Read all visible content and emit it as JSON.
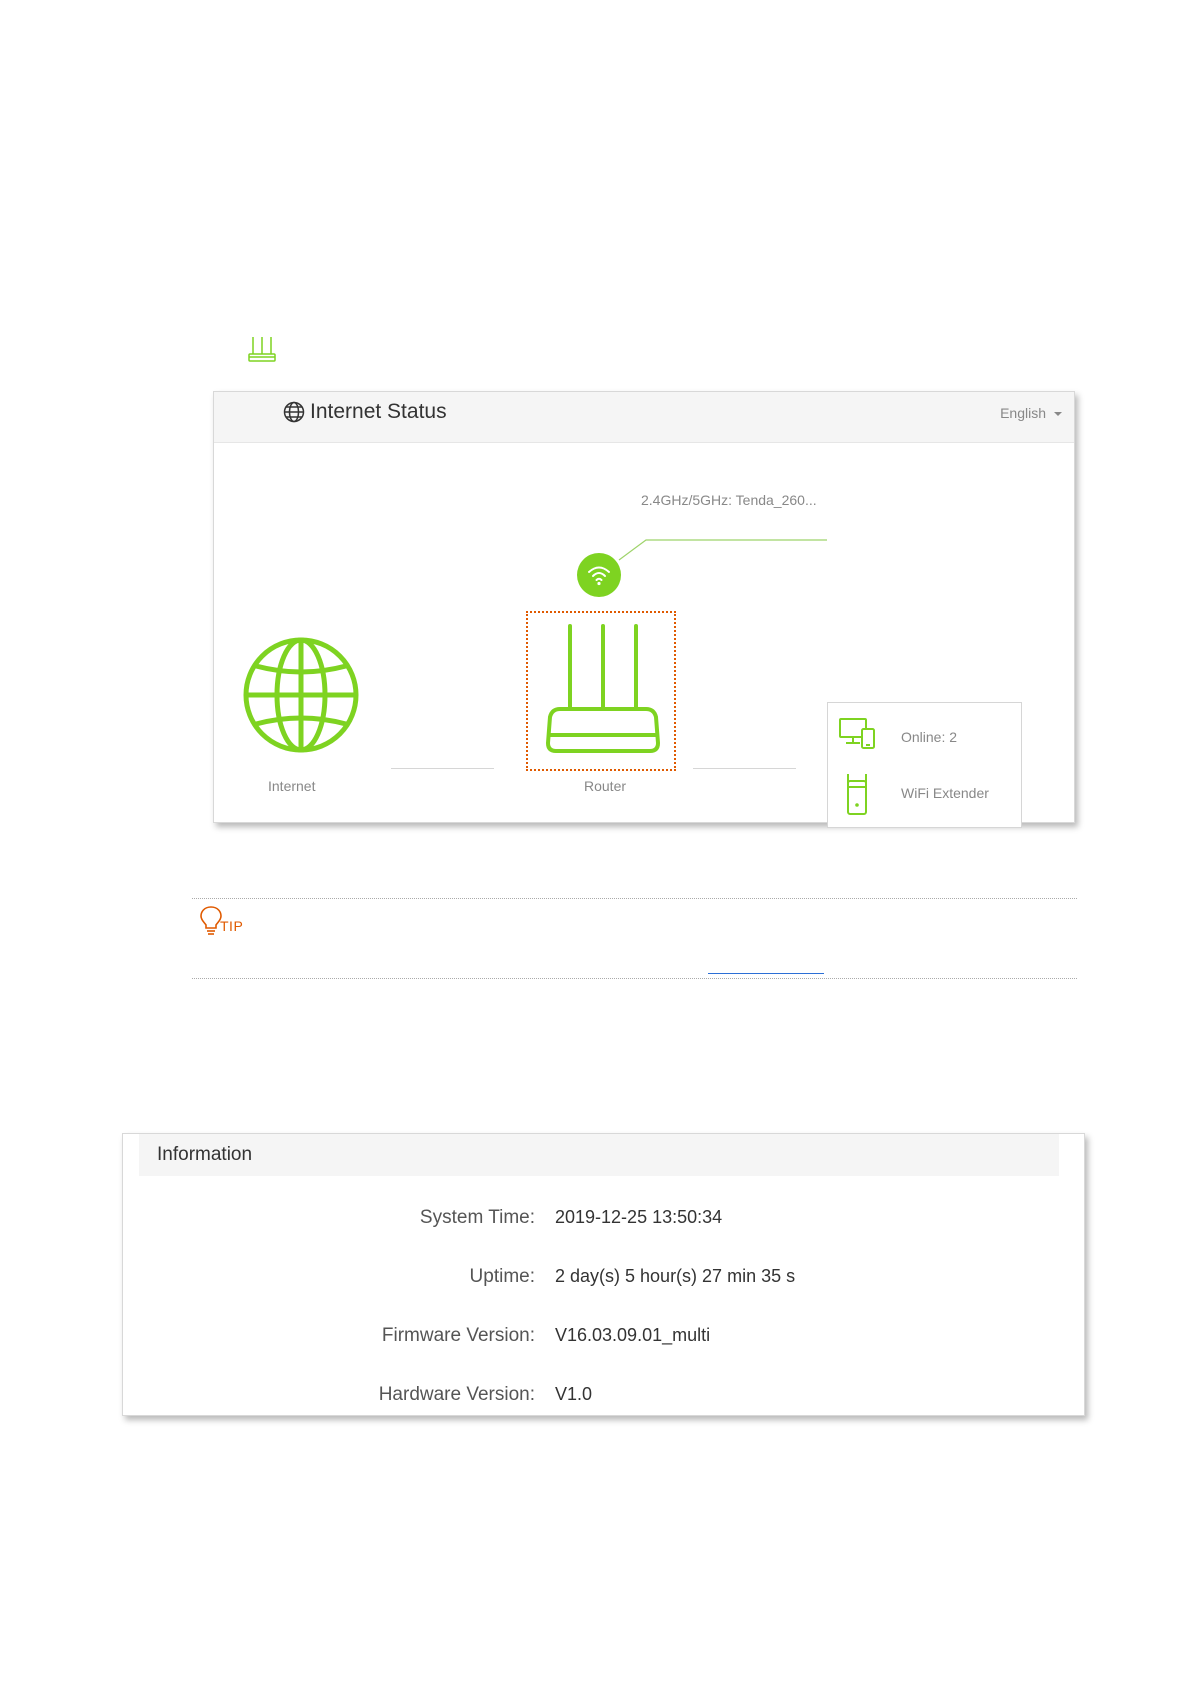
{
  "status_panel": {
    "title": "Internet Status",
    "language": "English",
    "ssid": "2.4GHz/5GHz: Tenda_260...",
    "internet_label": "Internet",
    "router_label": "Router",
    "online_label": "Online:  2",
    "extender_label": "WiFi Extender"
  },
  "tip": {
    "label": "TIP"
  },
  "information": {
    "title": "Information",
    "rows": [
      {
        "label": "System Time:",
        "value": "2019-12-25 13:50:34"
      },
      {
        "label": "Uptime:",
        "value": "2 day(s) 5 hour(s) 27 min 35 s"
      },
      {
        "label": "Firmware Version:",
        "value": "V16.03.09.01_multi"
      },
      {
        "label": "Hardware Version:",
        "value": "V1.0"
      }
    ]
  },
  "colors": {
    "accent_green": "#7ed321",
    "highlight_orange": "#e05a00",
    "link_blue": "#2b6fd6"
  }
}
